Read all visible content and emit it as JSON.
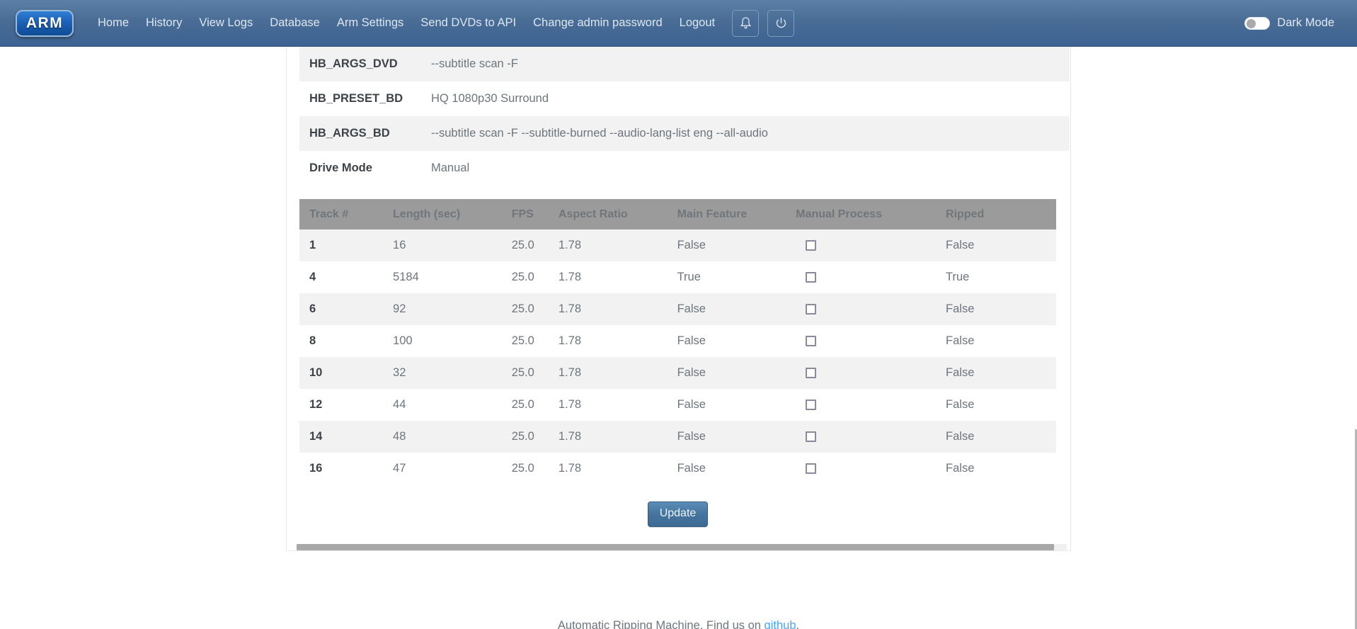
{
  "navbar": {
    "brand": "ARM",
    "links": [
      {
        "label": "Home"
      },
      {
        "label": "History"
      },
      {
        "label": "View Logs"
      },
      {
        "label": "Database"
      },
      {
        "label": "Arm Settings"
      },
      {
        "label": "Send DVDs to API"
      },
      {
        "label": "Change admin password"
      },
      {
        "label": "Logout"
      }
    ],
    "notifications_icon": "bell-icon",
    "power_icon": "power-icon",
    "dark_mode_label": "Dark Mode",
    "dark_mode_enabled": false,
    "bg_color": "#3d6291",
    "text_color": "#dce6f1"
  },
  "info_table": {
    "rows": [
      {
        "label": "HB_ARGS_DVD",
        "value": "--subtitle scan -F"
      },
      {
        "label": "HB_PRESET_BD",
        "value": "HQ 1080p30 Surround"
      },
      {
        "label": "HB_ARGS_BD",
        "value": "--subtitle scan -F --subtitle-burned --audio-lang-list eng --all-audio"
      },
      {
        "label": "Drive Mode",
        "value": "Manual"
      }
    ]
  },
  "tracks_table": {
    "headers": [
      "Track #",
      "Length (sec)",
      "FPS",
      "Aspect Ratio",
      "Main Feature",
      "Manual Process",
      "Ripped"
    ],
    "header_bg": "#9b9b9b",
    "rows": [
      {
        "track": "1",
        "length": "16",
        "fps": "25.0",
        "aspect": "1.78",
        "main_feature": "False",
        "manual_process": false,
        "ripped": "False"
      },
      {
        "track": "4",
        "length": "5184",
        "fps": "25.0",
        "aspect": "1.78",
        "main_feature": "True",
        "manual_process": false,
        "ripped": "True"
      },
      {
        "track": "6",
        "length": "92",
        "fps": "25.0",
        "aspect": "1.78",
        "main_feature": "False",
        "manual_process": false,
        "ripped": "False"
      },
      {
        "track": "8",
        "length": "100",
        "fps": "25.0",
        "aspect": "1.78",
        "main_feature": "False",
        "manual_process": false,
        "ripped": "False"
      },
      {
        "track": "10",
        "length": "32",
        "fps": "25.0",
        "aspect": "1.78",
        "main_feature": "False",
        "manual_process": false,
        "ripped": "False"
      },
      {
        "track": "12",
        "length": "44",
        "fps": "25.0",
        "aspect": "1.78",
        "main_feature": "False",
        "manual_process": false,
        "ripped": "False"
      },
      {
        "track": "14",
        "length": "48",
        "fps": "25.0",
        "aspect": "1.78",
        "main_feature": "False",
        "manual_process": false,
        "ripped": "False"
      },
      {
        "track": "16",
        "length": "47",
        "fps": "25.0",
        "aspect": "1.78",
        "main_feature": "False",
        "manual_process": false,
        "ripped": "False"
      }
    ]
  },
  "actions": {
    "update_label": "Update"
  },
  "footer": {
    "text_before": "Automatic Ripping Machine. Find us on ",
    "link_label": "github",
    "text_after": ".",
    "link_color": "#4aa3ff"
  }
}
